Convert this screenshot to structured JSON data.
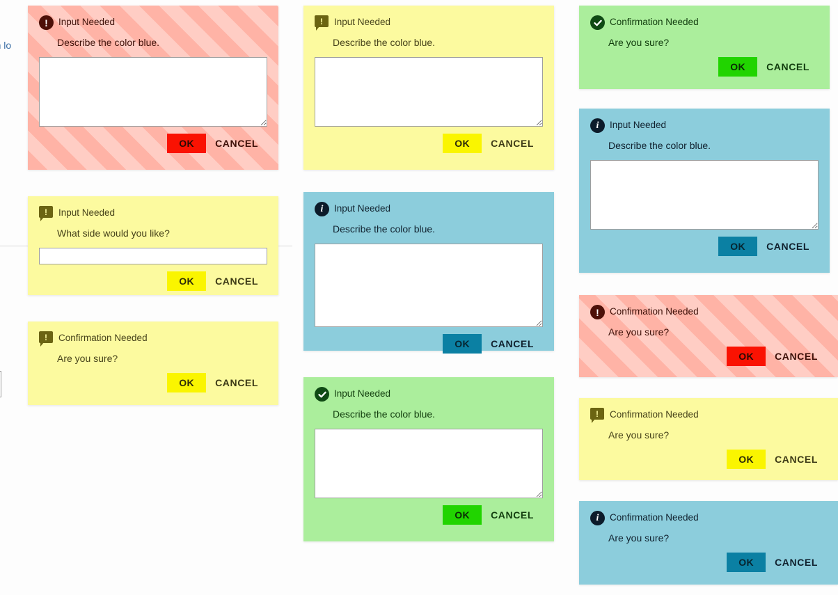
{
  "background": {
    "fragment_text": "een lo"
  },
  "labels": {
    "ok": "OK",
    "cancel": "CANCEL",
    "title_input": "Input Needed",
    "title_confirm": "Confirmation Needed",
    "msg_describe": "Describe the color blue.",
    "msg_side": "What side would you like?",
    "msg_sure": "Are you sure?"
  },
  "colors": {
    "yellow_bg": "#fcfa9f",
    "blue_bg": "#8ccddc",
    "green_bg": "#abee9c",
    "red_stripe_dark": "#ffb3a6",
    "red_stripe_light": "#ffcdc4",
    "ok_red": "#fa1202",
    "ok_yellow": "#faf500",
    "ok_blue": "#0b80a3",
    "ok_green": "#21d400"
  },
  "dialogs": [
    {
      "id": "red-input-1",
      "skin": "red",
      "icon": "alert-circle-icon",
      "title": "Input Needed",
      "message": "Describe the color blue.",
      "field": "textarea",
      "field_value": "",
      "ok": "OK",
      "cancel": "CANCEL"
    },
    {
      "id": "yellow-input-side",
      "skin": "yellow",
      "icon": "alert-bubble-icon",
      "title": "Input Needed",
      "message": "What side would you like?",
      "field": "text",
      "field_value": "",
      "ok": "OK",
      "cancel": "CANCEL"
    },
    {
      "id": "yellow-confirm-1",
      "skin": "yellow",
      "icon": "alert-bubble-icon",
      "title": "Confirmation Needed",
      "message": "Are you sure?",
      "field": "none",
      "field_value": "",
      "ok": "OK",
      "cancel": "CANCEL"
    },
    {
      "id": "yellow-input-1",
      "skin": "yellow",
      "icon": "alert-bubble-icon",
      "title": "Input Needed",
      "message": "Describe the color blue.",
      "field": "textarea",
      "field_value": "",
      "ok": "OK",
      "cancel": "CANCEL"
    },
    {
      "id": "blue-input-1",
      "skin": "blue",
      "icon": "info-circle-icon",
      "title": "Input Needed",
      "message": "Describe the color blue.",
      "field": "textarea",
      "field_value": "",
      "ok": "OK",
      "cancel": "CANCEL"
    },
    {
      "id": "green-input-1",
      "skin": "green",
      "icon": "check-circle-icon",
      "title": "Input Needed",
      "message": "Describe the color blue.",
      "field": "textarea",
      "field_value": "",
      "ok": "OK",
      "cancel": "CANCEL"
    },
    {
      "id": "green-confirm-1",
      "skin": "green",
      "icon": "check-circle-icon",
      "title": "Confirmation Needed",
      "message": "Are you sure?",
      "field": "none",
      "field_value": "",
      "ok": "OK",
      "cancel": "CANCEL"
    },
    {
      "id": "blue-input-2",
      "skin": "blue",
      "icon": "info-circle-icon",
      "title": "Input Needed",
      "message": "Describe the color blue.",
      "field": "textarea",
      "field_value": "",
      "ok": "OK",
      "cancel": "CANCEL"
    },
    {
      "id": "red-confirm-1",
      "skin": "red",
      "icon": "alert-circle-icon",
      "title": "Confirmation Needed",
      "message": "Are you sure?",
      "field": "none",
      "field_value": "",
      "ok": "OK",
      "cancel": "CANCEL"
    },
    {
      "id": "yellow-confirm-2",
      "skin": "yellow",
      "icon": "alert-bubble-icon",
      "title": "Confirmation Needed",
      "message": "Are you sure?",
      "field": "none",
      "field_value": "",
      "ok": "OK",
      "cancel": "CANCEL"
    },
    {
      "id": "blue-confirm-1",
      "skin": "blue",
      "icon": "info-circle-icon",
      "title": "Confirmation Needed",
      "message": "Are you sure?",
      "field": "none",
      "field_value": "",
      "ok": "OK",
      "cancel": "CANCEL"
    }
  ]
}
